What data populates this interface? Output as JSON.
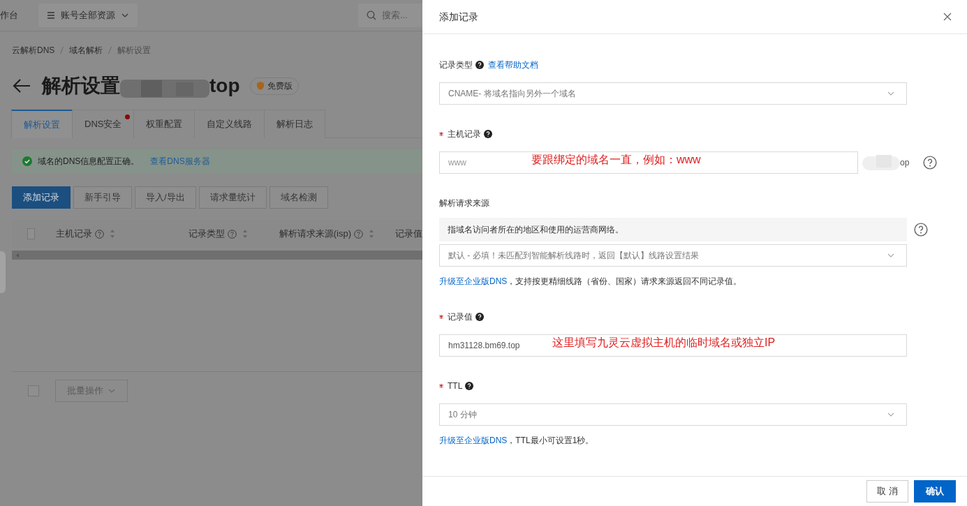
{
  "topbar": {
    "workbench": "作台",
    "resource_menu": "账号全部资源",
    "search": {
      "placeholder": "搜索..."
    }
  },
  "breadcrumb": [
    "云解析DNS",
    "域名解析",
    "解析设置"
  ],
  "page_title": {
    "title": "解析设置",
    "domain_suffix": "top",
    "badge": "免费版"
  },
  "tabs": [
    {
      "label": "解析设置",
      "selected": true,
      "dot": false
    },
    {
      "label": "DNS安全",
      "selected": false,
      "dot": true
    },
    {
      "label": "权重配置",
      "selected": false,
      "dot": false
    },
    {
      "label": "自定义线路",
      "selected": false,
      "dot": false
    },
    {
      "label": "解析日志",
      "selected": false,
      "dot": false
    }
  ],
  "alert": {
    "text": "域名的DNS信息配置正确。",
    "link": "查看DNS服务器"
  },
  "actions": [
    {
      "label": "添加记录",
      "kind": "primary"
    },
    {
      "label": "新手引导",
      "kind": "normal"
    },
    {
      "label": "导入/导出",
      "kind": "normal"
    },
    {
      "label": "请求量统计",
      "kind": "normal"
    },
    {
      "label": "域名检测",
      "kind": "normal"
    }
  ],
  "table": {
    "select_all": {
      "checked": false
    },
    "columns": [
      {
        "label": "主机记录",
        "sortable": true
      },
      {
        "label": "记录类型",
        "sortable": true
      },
      {
        "label": "解析请求来源(isp)",
        "sortable": true
      },
      {
        "label": "记录值"
      }
    ]
  },
  "batch": {
    "checked": false,
    "label": "批量操作"
  },
  "drawer": {
    "title": "添加记录",
    "fields": [
      {
        "kind": "select",
        "label": "记录类型",
        "required": false,
        "help": true,
        "help_link": "查看帮助文档",
        "value": "CNAME- 将域名指向另外一个域名"
      },
      {
        "kind": "input",
        "label": "主机记录",
        "required": true,
        "help": true,
        "placeholder": "www",
        "suffix": "op",
        "side_help": true,
        "annotation": "要跟绑定的域名一直，例如：www"
      },
      {
        "kind": "select",
        "label": "解析请求来源",
        "required": false,
        "help": false,
        "description": "指域名访问者所在的地区和使用的运营商网络。",
        "side_help": true,
        "value": "默认 - 必填！未匹配到智能解析线路时，返回【默认】线路设置结果",
        "note_link": "升级至企业版DNS",
        "note": "，支持按更精细线路（省份、国家）请求来源返回不同记录值。"
      },
      {
        "kind": "input",
        "label": "记录值",
        "required": true,
        "help": true,
        "value": "hm31128.bm69.top",
        "annotation": "这里填写九灵云虚拟主机的临时域名或独立IP"
      },
      {
        "kind": "select",
        "label": "TTL",
        "required": true,
        "help": true,
        "value": "10 分钟",
        "note_link": "升级至企业版DNS",
        "note": "，TTL最小可设置1秒。"
      }
    ],
    "buttons": [
      {
        "label": "取 消",
        "kind": "normal"
      },
      {
        "label": "确认",
        "kind": "primary"
      }
    ]
  }
}
